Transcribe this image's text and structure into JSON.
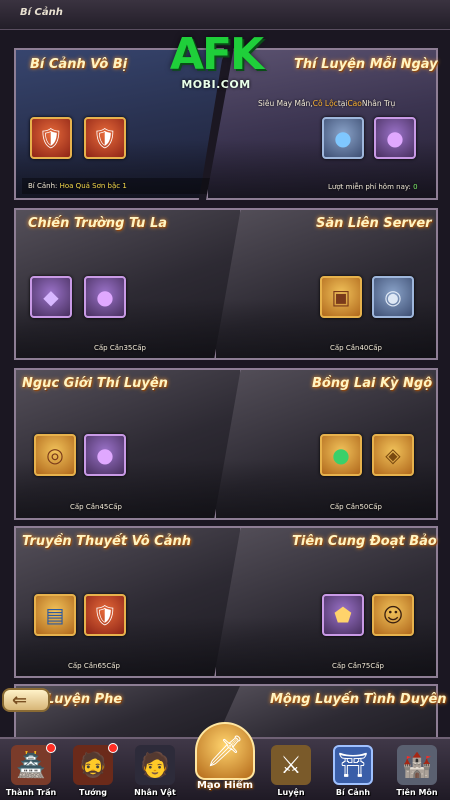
{
  "header": {
    "title": "Bí Cảnh"
  },
  "logo": {
    "big": "AFK",
    "small": "MOBI.COM"
  },
  "cards": {
    "bi_canh_vo_bi": {
      "title": "Bí Cảnh Vô Bị",
      "info_prefix": "Bí Cảnh:",
      "info_value": "Hoa Quả Sơn bậc 1",
      "items": [
        "armor-icon",
        "armor-icon"
      ]
    },
    "thi_luyen_moi_ngay": {
      "title": "Thí Luyện Mỗi Ngày",
      "desc_a": "Siêu May Mắn,",
      "desc_b": "Cô Lộc",
      "desc_c": "tại",
      "desc_d": "Cao",
      "desc_e": "Nhân Trụ",
      "free_label": "Lượt miễn phí hôm nay:",
      "free_count": "0",
      "items": [
        "blue-orb-icon",
        "purple-orb-icon"
      ]
    },
    "chien_truong_tu_la": {
      "title": "Chiến Trường Tu La",
      "level": "Cấp Cần35Cấp"
    },
    "san_lien_server": {
      "title": "Săn Liên Server",
      "level": "Cấp Cần40Cấp"
    },
    "nguc_gioi_thi_luyen": {
      "title": "Ngục Giới Thí Luyện",
      "level": "Cấp Cần45Cấp"
    },
    "bong_lai_ky_ngo": {
      "title": "Bồng Lai Kỳ Ngộ",
      "level": "Cấp Cần50Cấp"
    },
    "truyen_thuyet_vo_canh": {
      "title": "Truyền Thuyết Vô Cảnh",
      "level": "Cấp Cần65Cấp"
    },
    "tien_cung_doat_bao": {
      "title": "Tiên Cung Đoạt Bảo",
      "level": "Cấp Cần75Cấp"
    },
    "luyen_phe": {
      "title": "Luyện Phe"
    },
    "mong_luyen_tinh_duyen": {
      "title": "Mộng Luyến Tình Duyên"
    }
  },
  "nav": {
    "thanh_tran": "Thành Trấn",
    "tuong": "Tướng",
    "nhan_vat": "Nhân Vật",
    "mao_hiem": "Mạo Hiểm",
    "luyen": "Luyện",
    "bi_canh": "Bí Cảnh",
    "tien_mon": "Tiên Môn"
  },
  "colors": {
    "title_glow": "#ff9b2e",
    "accent_gold": "#e7b24c",
    "badge_red": "#ff2e24",
    "logo_green": "#1fcf3a"
  }
}
